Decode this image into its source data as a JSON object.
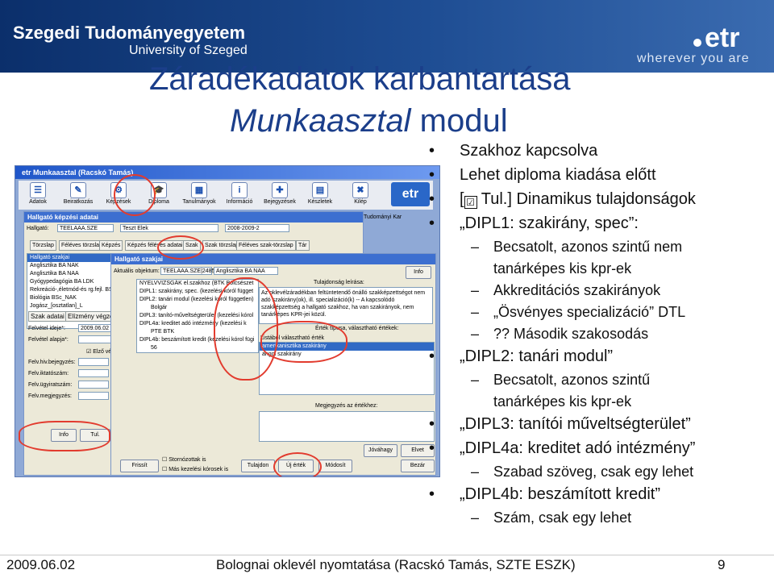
{
  "banner": {
    "university_line1": "Szegedi Tudományegyetem",
    "university_line2": "University of Szeged",
    "etr_logo": "etr",
    "etr_tagline": "wherever you are"
  },
  "slide": {
    "title_line1": "Záradékadatok karbantartása",
    "title_line2_italic": "Munkaasztal",
    "title_line2_rest": " modul"
  },
  "bullets": [
    {
      "level": 1,
      "text": "Szakhoz kapcsolva"
    },
    {
      "level": 1,
      "text": "Lehet diploma kiadása előtt"
    },
    {
      "level": 1,
      "prefix": "[",
      "checkbox": "☑",
      "text": " Tul.] Dinamikus tulajdonságok"
    },
    {
      "level": 1,
      "text": "„DIPL1: szakirány, spec”:"
    },
    {
      "level": 2,
      "text": "Becsatolt, azonos szintű nem"
    },
    {
      "level": 2,
      "text": "tanárképes kis kpr-ek",
      "continuation": true
    },
    {
      "level": 2,
      "text": "Akkreditációs szakirányok"
    },
    {
      "level": 2,
      "text": "„Ösvényes specializáció” DTL"
    },
    {
      "level": 2,
      "text": "?? Második szakosodás"
    },
    {
      "level": 1,
      "text": "„DIPL2: tanári modul”"
    },
    {
      "level": 2,
      "text": "Becsatolt, azonos szintű"
    },
    {
      "level": 2,
      "text": "tanárképes kis kpr-ek",
      "continuation": true
    },
    {
      "level": 1,
      "text": "„DIPL3: tanítói műveltségterület”"
    },
    {
      "level": 1,
      "text": "„DIPL4a: kreditet adó intézmény”"
    },
    {
      "level": 2,
      "text": "Szabad szöveg, csak egy lehet"
    },
    {
      "level": 1,
      "text": "„DIPL4b: beszámított kredit”"
    },
    {
      "level": 2,
      "text": "Szám, csak egy lehet"
    }
  ],
  "footer": {
    "date": "2009.06.02",
    "center": "Bolognai oklevél nyomtatása (Racskó Tamás, SZTE ESZK)",
    "page": "9"
  },
  "screenshot": {
    "window_title": "etr Munkaasztal (Racskó Tamás)",
    "toolbar": [
      "Adatok",
      "Beiratkozás",
      "Képzések",
      "Diploma",
      "Tanulmányok",
      "Információ",
      "Bejegyzések",
      "Készletek",
      "Kilép"
    ],
    "toolbar_icons": [
      "adatok-icon",
      "beiratkozas-icon",
      "kepzesek-icon",
      "diploma-icon",
      "tanulmanyok-icon",
      "informacio-icon",
      "bejegyzesek-icon",
      "keszletek-icon",
      "kilep-icon"
    ],
    "toolbar_glyphs": [
      "☰",
      "✎",
      "⚙",
      "🎓",
      "▦",
      "i",
      "✚",
      "▤",
      "✖"
    ],
    "etr_badge": "etr",
    "outer_panel_title": "Hallgató képzési adatai",
    "hallgato_label": "Hallgató:",
    "hallgato_value": "TEELAAA.SZE",
    "neptun_value": "Teszt Elek",
    "semester_value": "2008-2009-2",
    "faculty_value": "Tudományi Kar",
    "tabs": [
      "Törzslap",
      "Féléves törzslap",
      "Képzés",
      "Képzés féléves adatai",
      "Szak",
      "Szak törzslap",
      "Féléves szak-törzslap",
      "Tár"
    ],
    "program_list": [
      "Hallgató szakjai",
      "Anglisztika BA NAK",
      "Anglisztika BA NAA",
      "Gyógypedagógia BA LDK",
      "Rekreáció-,életmód-és rg.fejl. BSc",
      "Biológia BSc_NAK",
      "Jogász_[osztatlan]_L"
    ],
    "szak_adat_tabs": [
      "Szak adatai",
      "Elízmény végzettség"
    ],
    "felvetel_ideje_label": "Felvétel ideje*:",
    "felvetel_ideje_value": "2009.06.02",
    "felvetel_alapja_label": "Felvétel alapja*:",
    "elozo_vegz": "Elző végz",
    "felv_fields": [
      "Felv.hiv.bejegyzés:",
      "Felv.iktatószám:",
      "Felv.ügyiratszám:",
      "Felv.megjegyzés:"
    ],
    "inner_panel_title": "Hallgató szakjai",
    "inner_code": "TEELAAA.SZE|2485",
    "inner_prog": "Anglisztika BA NAA",
    "aktualis_label": "Aktuális objektum:",
    "info_btn": "Info",
    "tree": [
      "NYELVVIZSGÁK el.szakhoz (BTK Bölcsészet",
      "DIPL1: szakirány, spec. (kezelési kóról függet",
      "DIPL2: tanári modul (kezelési kóról független)",
      "Bolgár",
      "DIPL3: tanító-műveltségterület (kezelési kórol",
      "DIPL4a: kreditet adó intézmény (kezelési k",
      "PTE BTK",
      "DIPL4b: beszámított kredit (kezelési kórol fügi",
      "56"
    ],
    "tulajdonsag_label": "Tulajdonság leírása:",
    "tulajdonsag_text": "Az oklevélzáradékban feltüntetendő önálló szakképzettségot nem adó szakirány(ok), ill. specializáció(k) -- A kapcsolódó szakképzettség a hallgató szakhoz, ha van szakirányok, nem tanárképes KPR-jei közül.",
    "ertek_label": "Érték típusa, választható értékek:",
    "ertek_sub": "Listából választható érték",
    "ertek_options": [
      "amerikanisztika szakirány",
      "angol szakirány"
    ],
    "megjegyzes_label": "Megjegyzés az értékhez:",
    "bottom_left_btns": [
      "Info",
      "Tul."
    ],
    "bottom_btns": [
      "Frissít",
      "Tulajdon",
      "Új érték",
      "Módosít",
      "Jóváhagy",
      "Elvet",
      "Bezár"
    ],
    "checkboxes": [
      "Stornózottak is",
      "Más kezelési kórosek is"
    ]
  }
}
